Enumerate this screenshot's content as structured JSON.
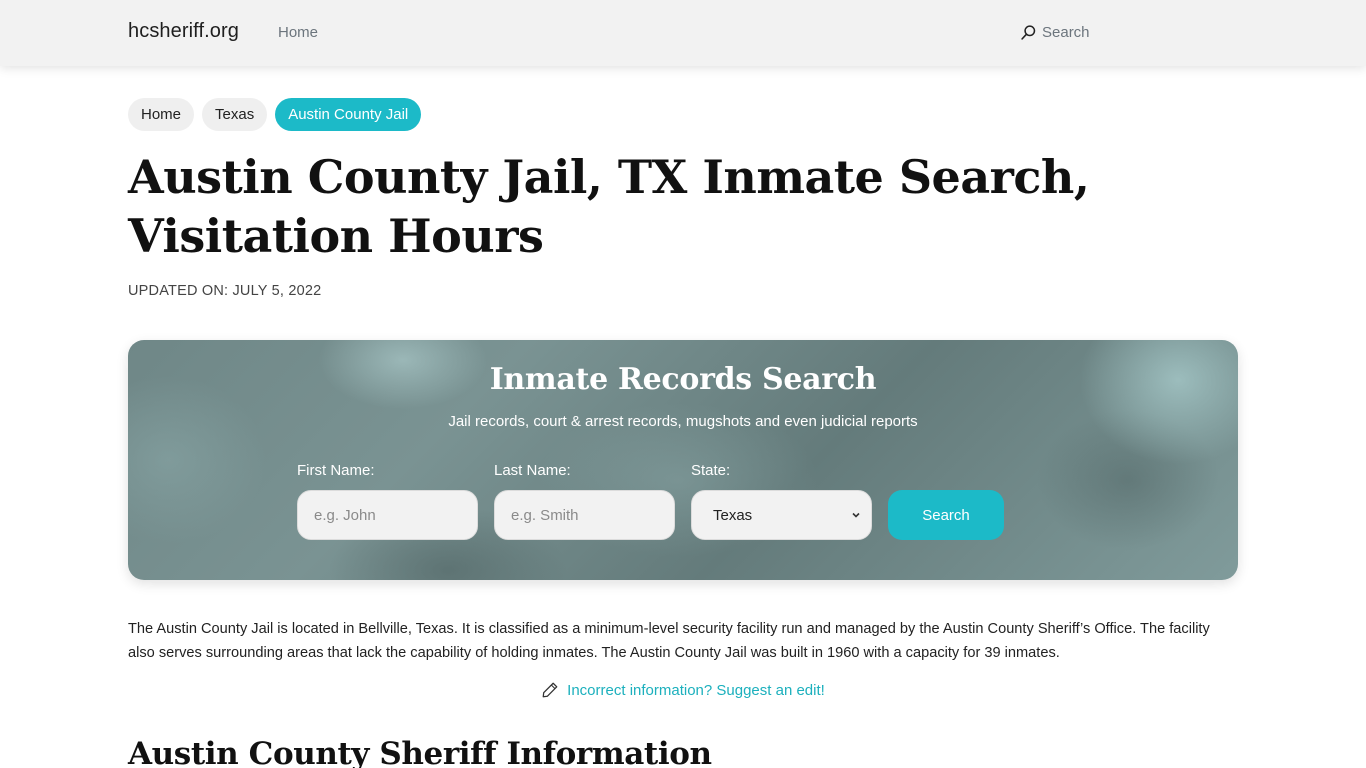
{
  "navbar": {
    "brand": "hcsheriff.org",
    "home_link": "Home",
    "search_label": "Search",
    "search_icon": "search-icon"
  },
  "breadcrumb": [
    {
      "label": "Home",
      "active": false
    },
    {
      "label": "Texas",
      "active": false
    },
    {
      "label": "Austin County Jail",
      "active": true
    }
  ],
  "page": {
    "title": "Austin County Jail, TX Inmate Search, Visitation Hours",
    "updated": "UPDATED ON: JULY 5, 2022"
  },
  "search_panel": {
    "title": "Inmate Records Search",
    "subtitle": "Jail records, court & arrest records, mugshots and even judicial reports",
    "first_name": {
      "label": "First Name:",
      "placeholder": "e.g. John",
      "value": ""
    },
    "last_name": {
      "label": "Last Name:",
      "placeholder": "e.g. Smith",
      "value": ""
    },
    "state": {
      "label": "State:",
      "selected": "Texas"
    },
    "button_label": "Search"
  },
  "content": {
    "intro": "The Austin County Jail is located in Bellville, Texas. It is classified as a minimum-level security facility run and managed by the Austin County Sheriff’s Office. The facility also serves surrounding areas that lack the capability of holding inmates. The Austin County Jail was built in 1960 with a capacity for 39 inmates.",
    "edit_link": "Incorrect information? Suggest an edit!",
    "edit_icon": "pencil-icon",
    "section_heading": "Austin County Sheriff Information"
  },
  "colors": {
    "accent": "#1cbac8",
    "navbar_bg": "#f2f2f2",
    "link": "#1cb0bd"
  }
}
